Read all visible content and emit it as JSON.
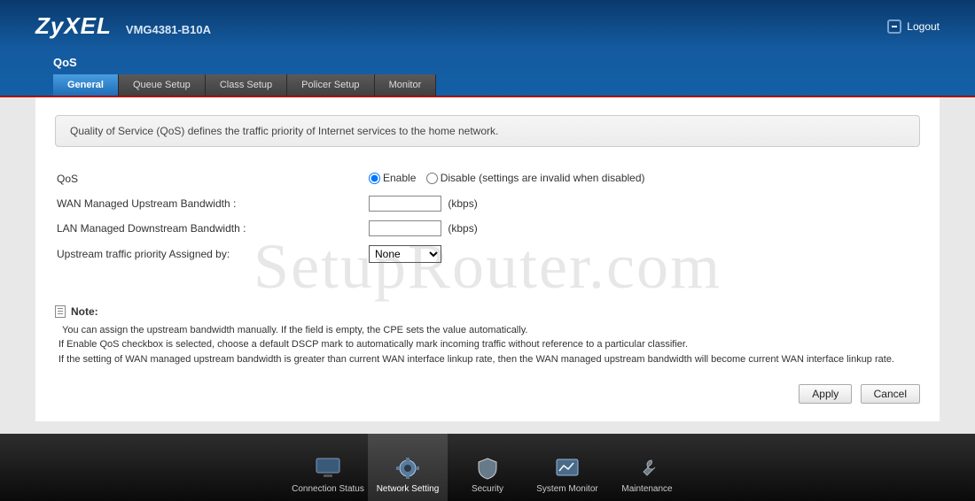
{
  "brand": "ZyXEL",
  "model": "VMG4381-B10A",
  "logout": "Logout",
  "section": "QoS",
  "tabs": {
    "t0": "General",
    "t1": "Queue Setup",
    "t2": "Class Setup",
    "t3": "Policer Setup",
    "t4": "Monitor"
  },
  "info": "Quality of Service (QoS) defines the traffic priority of Internet services to the home network.",
  "form": {
    "qos_label": "QoS",
    "enable": "Enable",
    "disable": "Disable (settings are invalid when disabled)",
    "wan_label": "WAN Managed Upstream Bandwidth :",
    "wan_value": "",
    "lan_label": "LAN Managed Downstream Bandwidth :",
    "lan_value": "",
    "kbps": "(kbps)",
    "upstream_label": "Upstream traffic priority Assigned by:",
    "upstream_selected": "None"
  },
  "note": {
    "title": "Note:",
    "l1": "You can assign the upstream bandwidth manually. If the field is empty, the CPE sets the value automatically.",
    "l2": "If Enable QoS checkbox is selected, choose a default DSCP mark to automatically mark incoming traffic without reference to a particular classifier.",
    "l3": "If the setting of WAN managed upstream bandwidth is greater than current WAN interface linkup rate, then the WAN managed upstream bandwidth will become current WAN interface linkup rate."
  },
  "buttons": {
    "apply": "Apply",
    "cancel": "Cancel"
  },
  "nav": {
    "n0": "Connection Status",
    "n1": "Network Setting",
    "n2": "Security",
    "n3": "System Monitor",
    "n4": "Maintenance"
  },
  "watermark": "SetupRouter.com"
}
